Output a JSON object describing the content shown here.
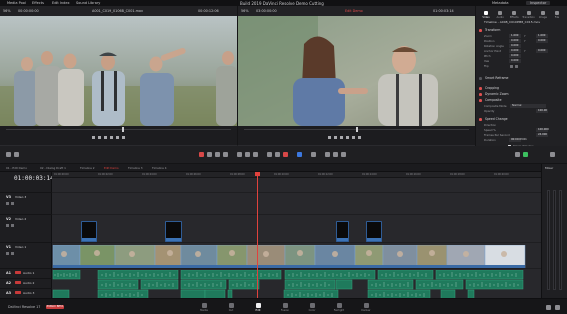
{
  "app": {
    "project_title": "Build 2019 DaVinci Resolve Demo Cutting",
    "name": "DaVinci Resolve 17",
    "beta_label": "PUBLIC BETA"
  },
  "topbar": {
    "media_pool": "Media Pool",
    "effects": "Effects",
    "edit_index": "Edit Index",
    "sound_library": "Sound Library",
    "mixer": "Mixer",
    "metadata": "Metadata",
    "inspector": "Inspector"
  },
  "source_viewer": {
    "zoom": "56%",
    "source_tc": "00:00:00:00",
    "clip_name": "A001_C019_0106B_C001.mov",
    "duration_tc": "00:00:12:06"
  },
  "timeline_viewer": {
    "zoom": "56%",
    "record_tc": "03:00:00:00",
    "timeline_name": "Edit Demo",
    "current_tc": "01:00:03:14"
  },
  "inspector": {
    "tabs": [
      "Video",
      "Audio",
      "Effects",
      "Transition",
      "Image",
      "File"
    ],
    "clip_name": "Timeline - A008_C010PM8_CX15.mov",
    "transform_section": "Transform",
    "transform_rows": [
      {
        "label": "Zoom",
        "x": "1.000",
        "label2": "Y",
        "y": "1.000"
      },
      {
        "label": "Position",
        "x": "0.000",
        "label2": "Y",
        "y": "0.000"
      },
      {
        "label": "Rotation Angle",
        "x": "0.000"
      },
      {
        "label": "Anchor Point",
        "x": "0.000",
        "label2": "Y",
        "y": "0.000"
      },
      {
        "label": "Pitch",
        "x": "0.000"
      },
      {
        "label": "Yaw",
        "x": "0.000"
      },
      {
        "label": "Flip",
        "x": ""
      }
    ],
    "smart_reframe_section": "Smart Reframe",
    "cropping_section": "Cropping",
    "dynamic_zoom_section": "Dynamic Zoom",
    "composite_section": "Composite",
    "composite_mode_label": "Composite Mode",
    "composite_mode_value": "Normal",
    "opacity_label": "Opacity",
    "opacity_value": "100.00",
    "speed_change_section": "Speed Change",
    "direction_label": "Direction",
    "speed_label": "Speed %",
    "speed_value": "100.000",
    "fps_label": "Frames Per Second",
    "fps_value": "24.000",
    "duration_label": "Duration",
    "duration_value": "00:00:03:01",
    "ripple_label": "Ripple Timeline",
    "pitch_label": "Pitch Correction"
  },
  "timeline": {
    "timecode": "01:00:03:14",
    "tabs": [
      "01 - Edit Demo",
      "02 - Dialog Draft 1",
      "Timeline 2",
      "Edit Demo",
      "Timeline 3",
      "Timeline 4"
    ],
    "ruler": [
      "01:00:00:00",
      "01:00:02:00",
      "01:00:04:00",
      "01:00:06:00",
      "01:00:08:00",
      "01:00:10:00",
      "01:00:12:00",
      "01:00:14:00",
      "01:00:16:00",
      "01:00:18:00",
      "01:00:20:00"
    ],
    "tracks": [
      {
        "id": "V3",
        "name": "Video 3"
      },
      {
        "id": "V2",
        "name": "Video 2"
      },
      {
        "id": "V1",
        "name": "Video 1"
      },
      {
        "id": "A1",
        "name": "Audio 1"
      },
      {
        "id": "A2",
        "name": "Audio 2"
      },
      {
        "id": "A3",
        "name": "Audio 3"
      }
    ],
    "mixer_label": "Mixer"
  },
  "pages": [
    {
      "label": "Media",
      "active": false
    },
    {
      "label": "Cut",
      "active": false
    },
    {
      "label": "Edit",
      "active": true
    },
    {
      "label": "Fusion",
      "active": false
    },
    {
      "label": "Color",
      "active": false
    },
    {
      "label": "Fairlight",
      "active": false
    },
    {
      "label": "Deliver",
      "active": false
    }
  ],
  "colors": {
    "accent_red": "#e0423d",
    "video_clip": "#466e9a",
    "audio_clip": "#1f7a5c",
    "title_clip_border": "#2f5c96"
  }
}
